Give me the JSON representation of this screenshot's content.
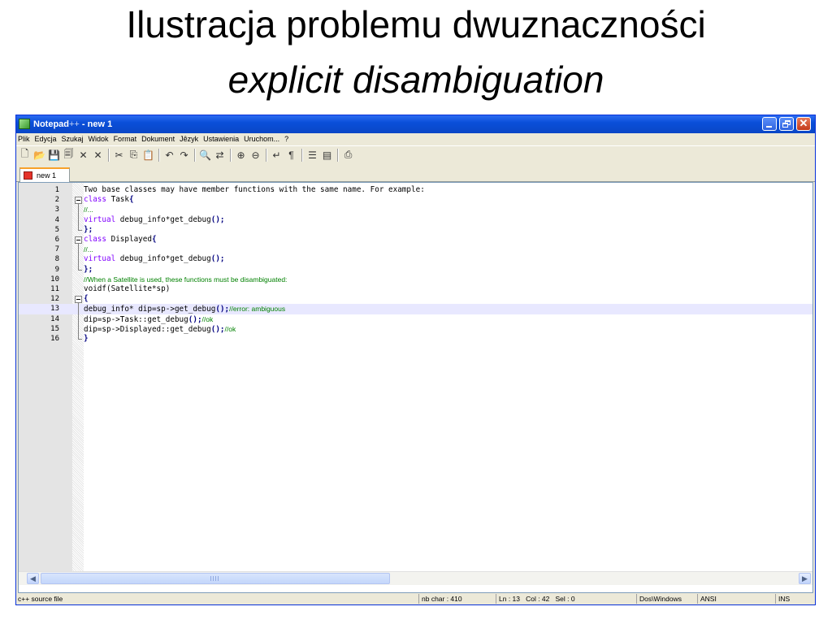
{
  "slide": {
    "title_line1": "Ilustracja problemu dwuznaczności",
    "title_line2": "explicit disambiguation"
  },
  "window": {
    "app_name": "Notepad",
    "app_suffix": "++",
    "doc_part": " - new 1"
  },
  "menu": [
    "Plik",
    "Edycja",
    "Szukaj",
    "Widok",
    "Format",
    "Dokument",
    "Jêzyk",
    "Ustawienia",
    "Uruchom...",
    "?"
  ],
  "toolbar_icons": [
    "new-file-icon",
    "open-folder-icon",
    "save-icon",
    "save-all-icon",
    "close-icon",
    "close-all-icon",
    "cut-icon",
    "copy-icon",
    "paste-icon",
    "undo-icon",
    "redo-icon",
    "find-icon",
    "replace-icon",
    "zoom-in-icon",
    "zoom-out-icon",
    "wrap-icon",
    "show-all-chars-icon",
    "indent-guide-icon",
    "user-lang-icon",
    "print-icon"
  ],
  "tab": {
    "label": "new 1"
  },
  "editor": {
    "current_line": 13,
    "lines": [
      {
        "num": "1",
        "code": "Two base classes may have member functions with the same name. For example:"
      },
      {
        "num": "2",
        "kw": "class",
        "code": " Task",
        "op": "{"
      },
      {
        "num": "3",
        "cm": "//..."
      },
      {
        "num": "4",
        "kw": "virtual",
        "code": " debug_info*get_debug",
        "op": "();"
      },
      {
        "num": "5",
        "op": "};"
      },
      {
        "num": "6",
        "kw": "class",
        "code": " Displayed",
        "op": "{"
      },
      {
        "num": "7",
        "cm": "//..."
      },
      {
        "num": "8",
        "kw": "virtual",
        "code": " debug_info*get_debug",
        "op": "();"
      },
      {
        "num": "9",
        "op": "};"
      },
      {
        "num": "10",
        "cm": "//When a Satellite is used, these functions must be disambiguated:"
      },
      {
        "num": "11",
        "code": "voidf(Satellite*sp)"
      },
      {
        "num": "12",
        "op": "{"
      },
      {
        "num": "13",
        "code": "debug_info* dip=sp->get_debug",
        "op": "();",
        "cm": "//error: ambiguous"
      },
      {
        "num": "14",
        "code": "dip=sp->Task::get_debug",
        "op": "();",
        "cm": "//ok"
      },
      {
        "num": "15",
        "code": "dip=sp->Displayed::get_debug",
        "op": "();",
        "cm": "//ok"
      },
      {
        "num": "16",
        "op": "}"
      }
    ]
  },
  "status": {
    "file_type": "c++ source file",
    "nb_char": "nb char : 410",
    "position": "Ln : 13   Col : 42   Sel : 0",
    "eol": "Dos\\Windows",
    "encoding": "ANSI",
    "mode": "INS"
  }
}
